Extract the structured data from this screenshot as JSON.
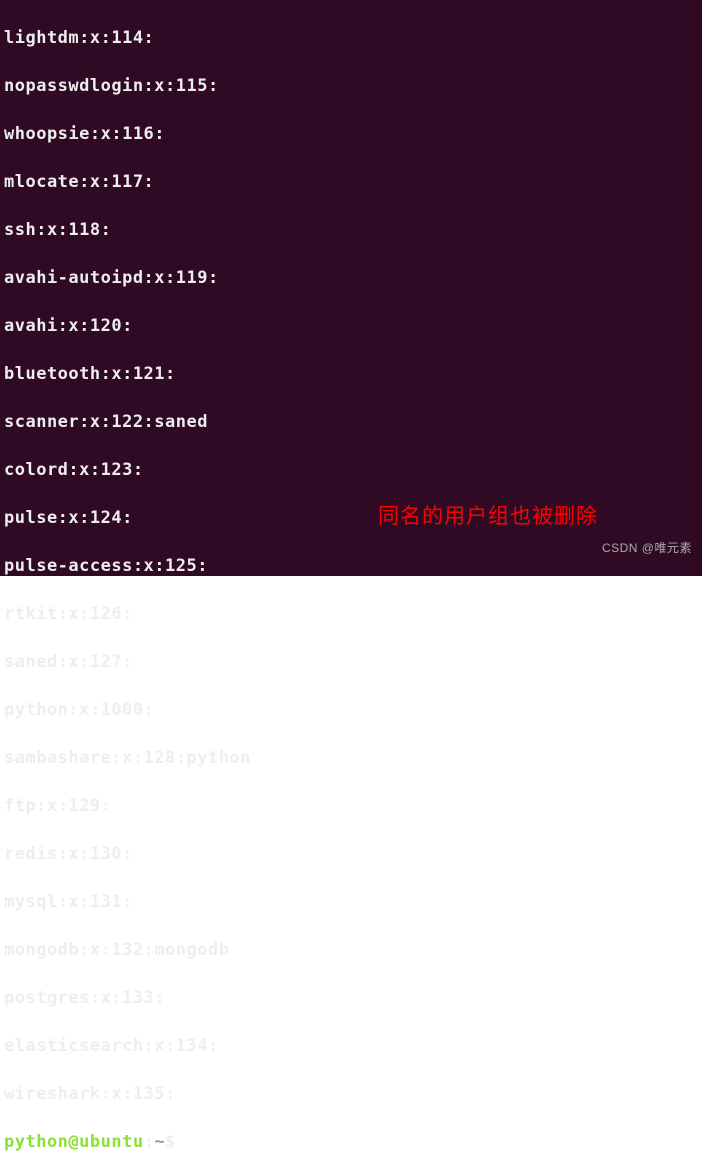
{
  "terminal": {
    "lines": [
      "lightdm:x:114:",
      "nopasswdlogin:x:115:",
      "whoopsie:x:116:",
      "mlocate:x:117:",
      "ssh:x:118:",
      "avahi-autoipd:x:119:",
      "avahi:x:120:",
      "bluetooth:x:121:",
      "scanner:x:122:saned",
      "colord:x:123:",
      "pulse:x:124:",
      "pulse-access:x:125:",
      "rtkit:x:126:",
      "saned:x:127:",
      "python:x:1000:",
      "sambashare:x:128:python",
      "ftp:x:129:",
      "redis:x:130:",
      "mysql:x:131:",
      "mongodb:x:132:mongodb",
      "postgres:x:133:",
      "elasticsearch:x:134:",
      "wireshark:x:135:"
    ],
    "prompt": {
      "user_host": "python@ubuntu",
      "colon": ":",
      "path": "~",
      "dollar": "$"
    }
  },
  "annotation": "同名的用户组也被删除",
  "watermark": "CSDN @唯元素"
}
